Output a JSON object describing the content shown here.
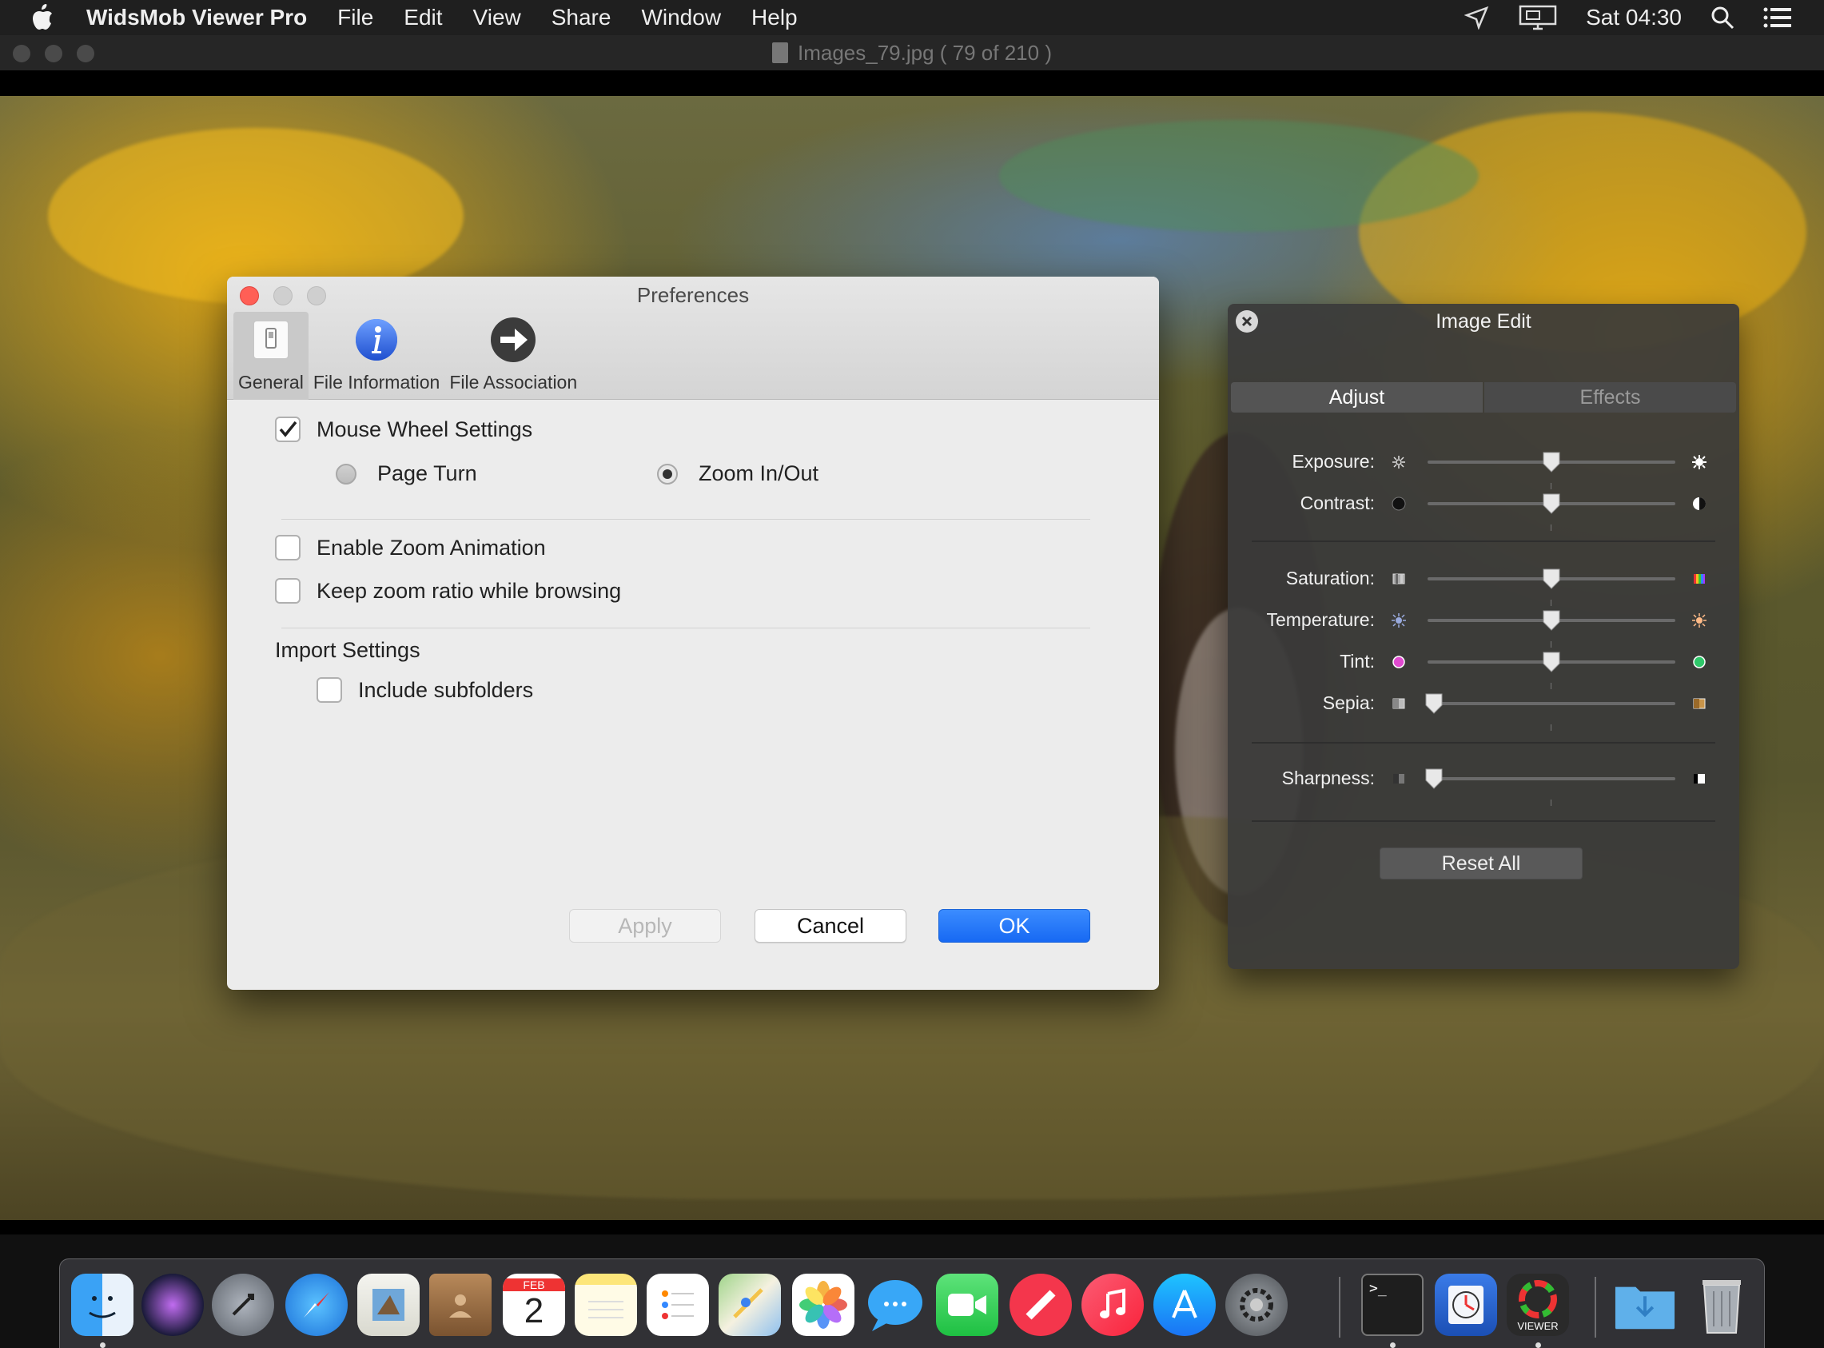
{
  "menubar": {
    "app_name": "WidsMob Viewer Pro",
    "menus": [
      "File",
      "Edit",
      "View",
      "Share",
      "Window",
      "Help"
    ],
    "clock": "Sat 04:30"
  },
  "viewer": {
    "file_title": "Images_79.jpg ( 79 of 210 )"
  },
  "preferences": {
    "title": "Preferences",
    "tabs": [
      {
        "label": "General",
        "icon": "switch-icon"
      },
      {
        "label": "File Information",
        "icon": "info-icon"
      },
      {
        "label": "File Association",
        "icon": "arrow-right-icon"
      }
    ],
    "mouse_wheel": {
      "label": "Mouse Wheel Settings",
      "checked": true
    },
    "radio_page_turn": "Page Turn",
    "radio_zoom": "Zoom In/Out",
    "enable_zoom_animation": "Enable Zoom Animation",
    "keep_zoom_ratio": "Keep zoom ratio while browsing",
    "import_settings": "Import Settings",
    "include_subfolders": "Include subfolders",
    "buttons": {
      "apply": "Apply",
      "cancel": "Cancel",
      "ok": "OK"
    }
  },
  "image_edit": {
    "title": "Image Edit",
    "tabs": {
      "adjust": "Adjust",
      "effects": "Effects"
    },
    "sliders": [
      {
        "label": "Exposure:",
        "value": 0.5
      },
      {
        "label": "Contrast:",
        "value": 0.5
      },
      {
        "label": "Saturation:",
        "value": 0.5
      },
      {
        "label": "Temperature:",
        "value": 0.5
      },
      {
        "label": "Tint:",
        "value": 0.5
      },
      {
        "label": "Sepia:",
        "value": 0.0
      },
      {
        "label": "Sharpness:",
        "value": 0.0
      }
    ],
    "reset_label": "Reset All"
  },
  "dock": {
    "apps": [
      "Finder",
      "Siri",
      "Launchpad",
      "Safari",
      "Mail",
      "Contacts",
      "Calendar",
      "Notes",
      "Reminders",
      "Maps",
      "Photos",
      "Messages",
      "FaceTime",
      "News",
      "Music",
      "App Store",
      "System Preferences",
      "Terminal",
      "Time Machine",
      "WidsMob Viewer",
      "Downloads",
      "Trash"
    ],
    "calendar_month": "FEB",
    "calendar_day": "2",
    "viewer_label": "VIEWER"
  },
  "colors": {
    "accent": "#1769f3",
    "close_red": "#ff5f56"
  }
}
